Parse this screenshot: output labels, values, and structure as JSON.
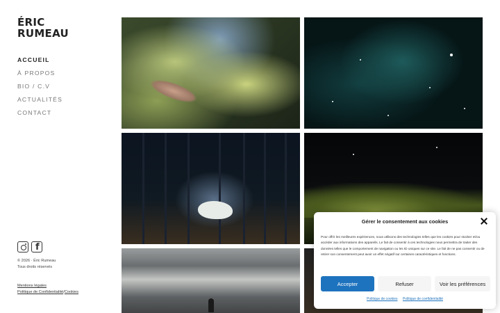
{
  "site": {
    "title_line1": "ÉRIC",
    "title_line2": "RUMEAU"
  },
  "nav": {
    "items": [
      {
        "label": "ACCUEIL",
        "active": true
      },
      {
        "label": "À PROPOS",
        "active": false
      },
      {
        "label": "BIO / C.V",
        "active": false
      },
      {
        "label": "ACTUALITÉS",
        "active": false
      },
      {
        "label": "CONTACT",
        "active": false
      }
    ]
  },
  "social": {
    "icons": [
      "instagram-icon",
      "facebook-icon"
    ]
  },
  "footer": {
    "copyright": "© 2026 · Éric Rumeau",
    "rights": "Tous droits réservés",
    "legal_mentions": "Mentions légales",
    "privacy_policy": "Politique de Confidentialité",
    "separator": "/",
    "cookies": "Cookies"
  },
  "cookie_banner": {
    "title": "Gérer le consentement aux cookies",
    "text": "Pour offrir les meilleures expériences, nous utilisons des technologies telles que les cookies pour stocker et/ou accéder aux informations des appareils. Le fait de consentir à ces technologies nous permettra de traiter des données telles que le comportement de navigation ou les ID uniques sur ce site. Le fait de ne pas consentir ou de retirer son consentement peut avoir un effet négatif sur certaines caractéristiques et fonctions.",
    "accept_label": "Accepter",
    "refuse_label": "Refuser",
    "preferences_label": "Voir les préférences",
    "cookie_policy_link": "Politique de cookies",
    "privacy_policy_link": "Politique de confidentialité",
    "accent_color": "#1e73be"
  }
}
